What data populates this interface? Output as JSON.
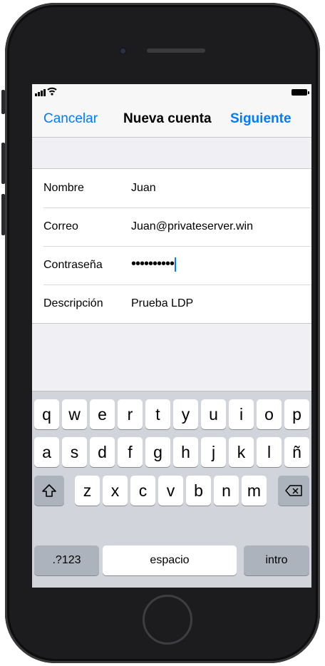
{
  "nav": {
    "cancel": "Cancelar",
    "title": "Nueva cuenta",
    "next": "Siguiente"
  },
  "form": [
    {
      "label": "Nombre",
      "value": "Juan"
    },
    {
      "label": "Correo",
      "value": "Juan@privateserver.win"
    },
    {
      "label": "Contraseña",
      "value": "••••••••••"
    },
    {
      "label": "Descripción",
      "value": "Prueba LDP"
    }
  ],
  "keyboard": {
    "row1": [
      "q",
      "w",
      "e",
      "r",
      "t",
      "y",
      "u",
      "i",
      "o",
      "p"
    ],
    "row2": [
      "a",
      "s",
      "d",
      "f",
      "g",
      "h",
      "j",
      "k",
      "l",
      "ñ"
    ],
    "row3": [
      "z",
      "x",
      "c",
      "v",
      "b",
      "n",
      "m"
    ],
    "numbers": ".?123",
    "space": "espacio",
    "return": "intro",
    "shift_glyph": "⇧"
  },
  "colors": {
    "accent": "#007aff",
    "phone_frame": "#1c1c1e"
  },
  "icons": [
    "signal-icon",
    "wifi-icon",
    "battery-icon",
    "shift-icon",
    "backspace-icon"
  ]
}
